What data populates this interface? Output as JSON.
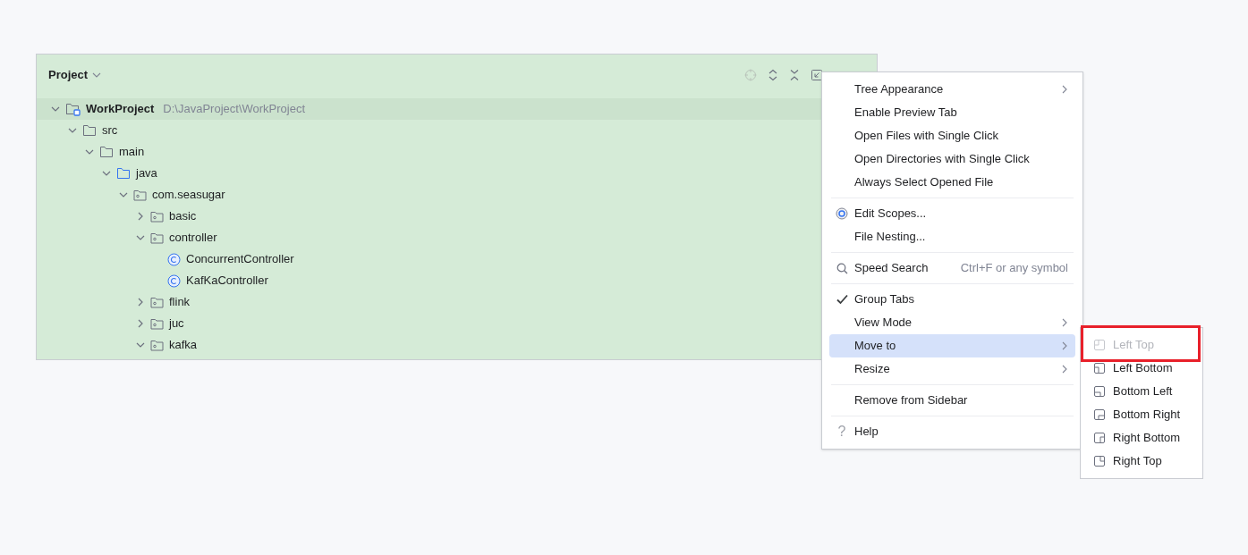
{
  "panel": {
    "title": "Project",
    "tree": [
      {
        "name": "WorkProject",
        "path": "D:\\JavaProject\\WorkProject",
        "kind": "project",
        "expanded": true,
        "children": [
          {
            "name": "src",
            "kind": "folder",
            "expanded": true,
            "children": [
              {
                "name": "main",
                "kind": "folder",
                "expanded": true,
                "children": [
                  {
                    "name": "java",
                    "kind": "source",
                    "expanded": true,
                    "children": [
                      {
                        "name": "com.seasugar",
                        "kind": "package",
                        "expanded": true,
                        "children": [
                          {
                            "name": "basic",
                            "kind": "package",
                            "expanded": false
                          },
                          {
                            "name": "controller",
                            "kind": "package",
                            "expanded": true,
                            "children": [
                              {
                                "name": "ConcurrentController",
                                "kind": "class"
                              },
                              {
                                "name": "KafKaController",
                                "kind": "class"
                              }
                            ]
                          },
                          {
                            "name": "flink",
                            "kind": "package",
                            "expanded": false
                          },
                          {
                            "name": "juc",
                            "kind": "package",
                            "expanded": false
                          },
                          {
                            "name": "kafka",
                            "kind": "package",
                            "expanded": true
                          }
                        ]
                      }
                    ]
                  }
                ]
              }
            ]
          }
        ]
      }
    ]
  },
  "menu": {
    "items": [
      {
        "kind": "plain",
        "label": "Tree Appearance",
        "submenu": true,
        "selected": false
      },
      {
        "kind": "plain",
        "label": "Enable Preview Tab",
        "submenu": false,
        "selected": false
      },
      {
        "kind": "plain",
        "label": "Open Files with Single Click",
        "submenu": false,
        "selected": false
      },
      {
        "kind": "plain",
        "label": "Open Directories with Single Click",
        "submenu": false,
        "selected": false
      },
      {
        "kind": "plain",
        "label": "Always Select Opened File",
        "submenu": false,
        "selected": false
      },
      {
        "kind": "separator"
      },
      {
        "kind": "radio",
        "label": "Edit Scopes...",
        "submenu": false,
        "selected": false
      },
      {
        "kind": "plain",
        "label": "File Nesting...",
        "submenu": false,
        "selected": false
      },
      {
        "kind": "separator"
      },
      {
        "kind": "search",
        "label": "Speed Search",
        "shortcut": "Ctrl+F or any symbol",
        "submenu": false,
        "selected": false
      },
      {
        "kind": "separator"
      },
      {
        "kind": "check",
        "label": "Group Tabs",
        "submenu": false,
        "selected": false
      },
      {
        "kind": "plain",
        "label": "View Mode",
        "submenu": true,
        "selected": false
      },
      {
        "kind": "plain",
        "label": "Move to",
        "submenu": true,
        "selected": true
      },
      {
        "kind": "plain",
        "label": "Resize",
        "submenu": true,
        "selected": false
      },
      {
        "kind": "separator"
      },
      {
        "kind": "plain",
        "label": "Remove from Sidebar",
        "submenu": false,
        "selected": false
      },
      {
        "kind": "separator"
      },
      {
        "kind": "help",
        "glyph": "?",
        "label": "Help",
        "submenu": false,
        "selected": false
      }
    ]
  },
  "submenu": {
    "items": [
      {
        "label": "Left Top",
        "kind": "left-top",
        "disabled": true,
        "highlighted": true
      },
      {
        "label": "Left Bottom",
        "kind": "left-bottom",
        "disabled": false,
        "highlighted": false
      },
      {
        "label": "Bottom Left",
        "kind": "bottom-left",
        "disabled": false,
        "highlighted": false
      },
      {
        "label": "Bottom Right",
        "kind": "bottom-right",
        "disabled": false,
        "highlighted": false
      },
      {
        "label": "Right Bottom",
        "kind": "right-bottom",
        "disabled": false,
        "highlighted": false
      },
      {
        "label": "Right Top",
        "kind": "right-top",
        "disabled": false,
        "highlighted": false
      }
    ]
  }
}
